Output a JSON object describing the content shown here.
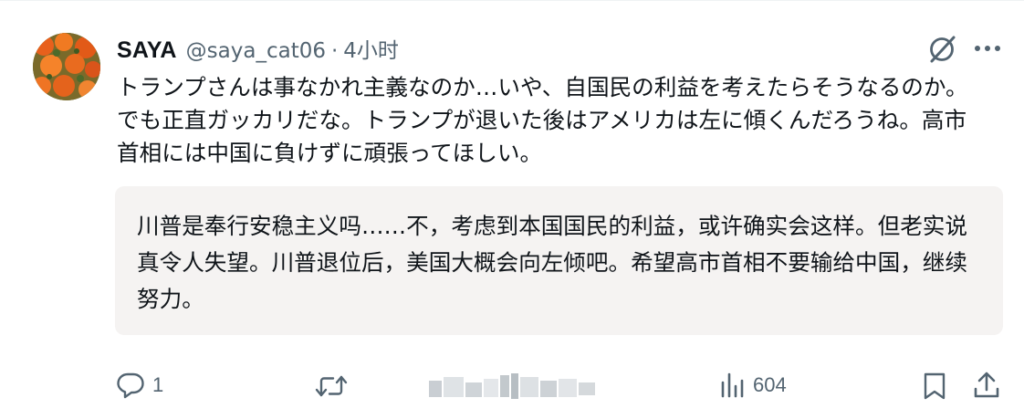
{
  "author": {
    "name": "SAYA",
    "handle": "@saya_cat06",
    "separator": "·",
    "time": "4小时"
  },
  "tweet": {
    "text": "トランプさんは事なかれ主義なのか…いや、自国民の利益を考えたらそうなるのか。でも正直ガッカリだな。トランプが退いた後はアメリカは左に傾くんだろうね。高市首相には中国に負けずに頑張ってほしい。"
  },
  "translation": {
    "text": "川普是奉行安稳主义吗……不，考虑到本国国民的利益，或许确实会这样。但老实说真令人失望。川普退位后，美国大概会向左倾吧。希望高市首相不要输给中国，继续努力。"
  },
  "actions": {
    "reply_count": "1",
    "repost_count": "",
    "views_count": "604"
  },
  "icons": {
    "header": [
      "grok-icon",
      "more-icon"
    ],
    "actions": [
      "reply-icon",
      "repost-icon",
      "views-icon",
      "bookmark-icon",
      "share-icon"
    ]
  },
  "colors": {
    "text": "#0f1419",
    "secondary": "#536471",
    "translation_bg": "#f5f3f2"
  }
}
